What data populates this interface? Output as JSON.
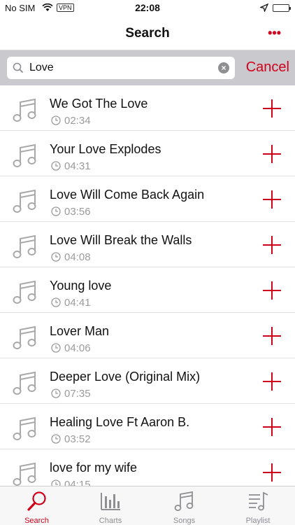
{
  "status": {
    "carrier": "No SIM",
    "vpn": "VPN",
    "time": "22:08"
  },
  "nav": {
    "title": "Search",
    "more": "•••"
  },
  "search": {
    "value": "Love",
    "cancel": "Cancel"
  },
  "songs": [
    {
      "title": "We Got The Love",
      "duration": "02:34"
    },
    {
      "title": "Your Love Explodes",
      "duration": "04:31"
    },
    {
      "title": "Love Will Come Back Again",
      "duration": "03:56"
    },
    {
      "title": "Love Will Break the Walls",
      "duration": "04:08"
    },
    {
      "title": "Young love",
      "duration": "04:41"
    },
    {
      "title": "Lover Man",
      "duration": "04:06"
    },
    {
      "title": "Deeper Love (Original Mix)",
      "duration": "07:35"
    },
    {
      "title": "Healing Love Ft Aaron B.",
      "duration": "03:52"
    },
    {
      "title": "love for my wife",
      "duration": "04:15"
    }
  ],
  "tabs": [
    {
      "label": "Search",
      "icon": "search-icon",
      "active": true
    },
    {
      "label": "Charts",
      "icon": "charts-icon",
      "active": false
    },
    {
      "label": "Songs",
      "icon": "music-note-icon",
      "active": false
    },
    {
      "label": "Playlist",
      "icon": "playlist-icon",
      "active": false
    }
  ],
  "colors": {
    "accent": "#d0021b",
    "searchBar": "#c9c9ce",
    "muted": "#9b9b9b"
  }
}
